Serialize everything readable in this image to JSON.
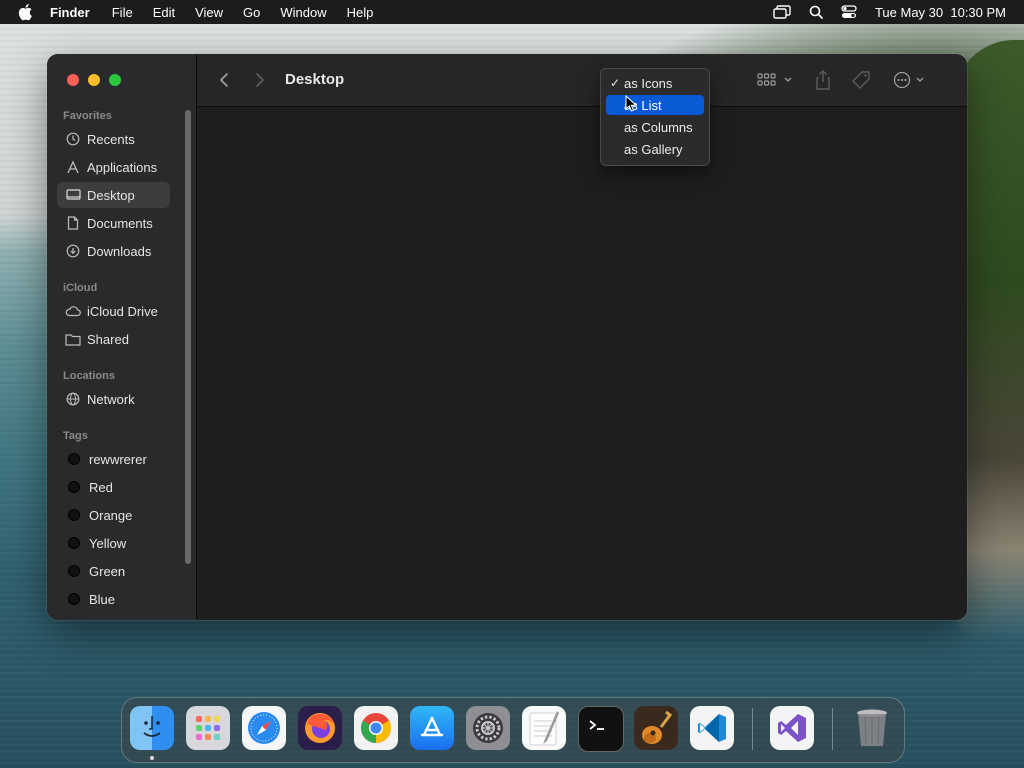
{
  "menubar": {
    "app_name": "Finder",
    "items": [
      "File",
      "Edit",
      "View",
      "Go",
      "Window",
      "Help"
    ],
    "clock": "Tue May 30  10:30 PM"
  },
  "window": {
    "title": "Desktop"
  },
  "sidebar": {
    "favorites_header": "Favorites",
    "favorites": [
      "Recents",
      "Applications",
      "Desktop",
      "Documents",
      "Downloads"
    ],
    "selected": "Desktop",
    "icloud_header": "iCloud",
    "icloud": [
      "iCloud Drive",
      "Shared"
    ],
    "locations_header": "Locations",
    "locations": [
      "Network"
    ],
    "tags_header": "Tags",
    "tags": [
      "rewwrerer",
      "Red",
      "Orange",
      "Yellow",
      "Green",
      "Blue"
    ]
  },
  "view_menu": {
    "items": [
      "as Icons",
      "as List",
      "as Columns",
      "as Gallery"
    ],
    "checked": "as Icons",
    "highlighted": "as List"
  },
  "dock": {
    "apps": [
      "Finder",
      "Launchpad",
      "Safari",
      "Firefox",
      "Chrome",
      "App Store",
      "System Settings",
      "TextEdit",
      "Terminal",
      "GarageBand",
      "Visual Studio Code",
      "Visual Studio",
      "Trash"
    ]
  },
  "colors": {
    "accent": "#0a5ad6",
    "close": "#fe5f57",
    "minimize": "#febc2e",
    "zoom": "#28c840"
  }
}
